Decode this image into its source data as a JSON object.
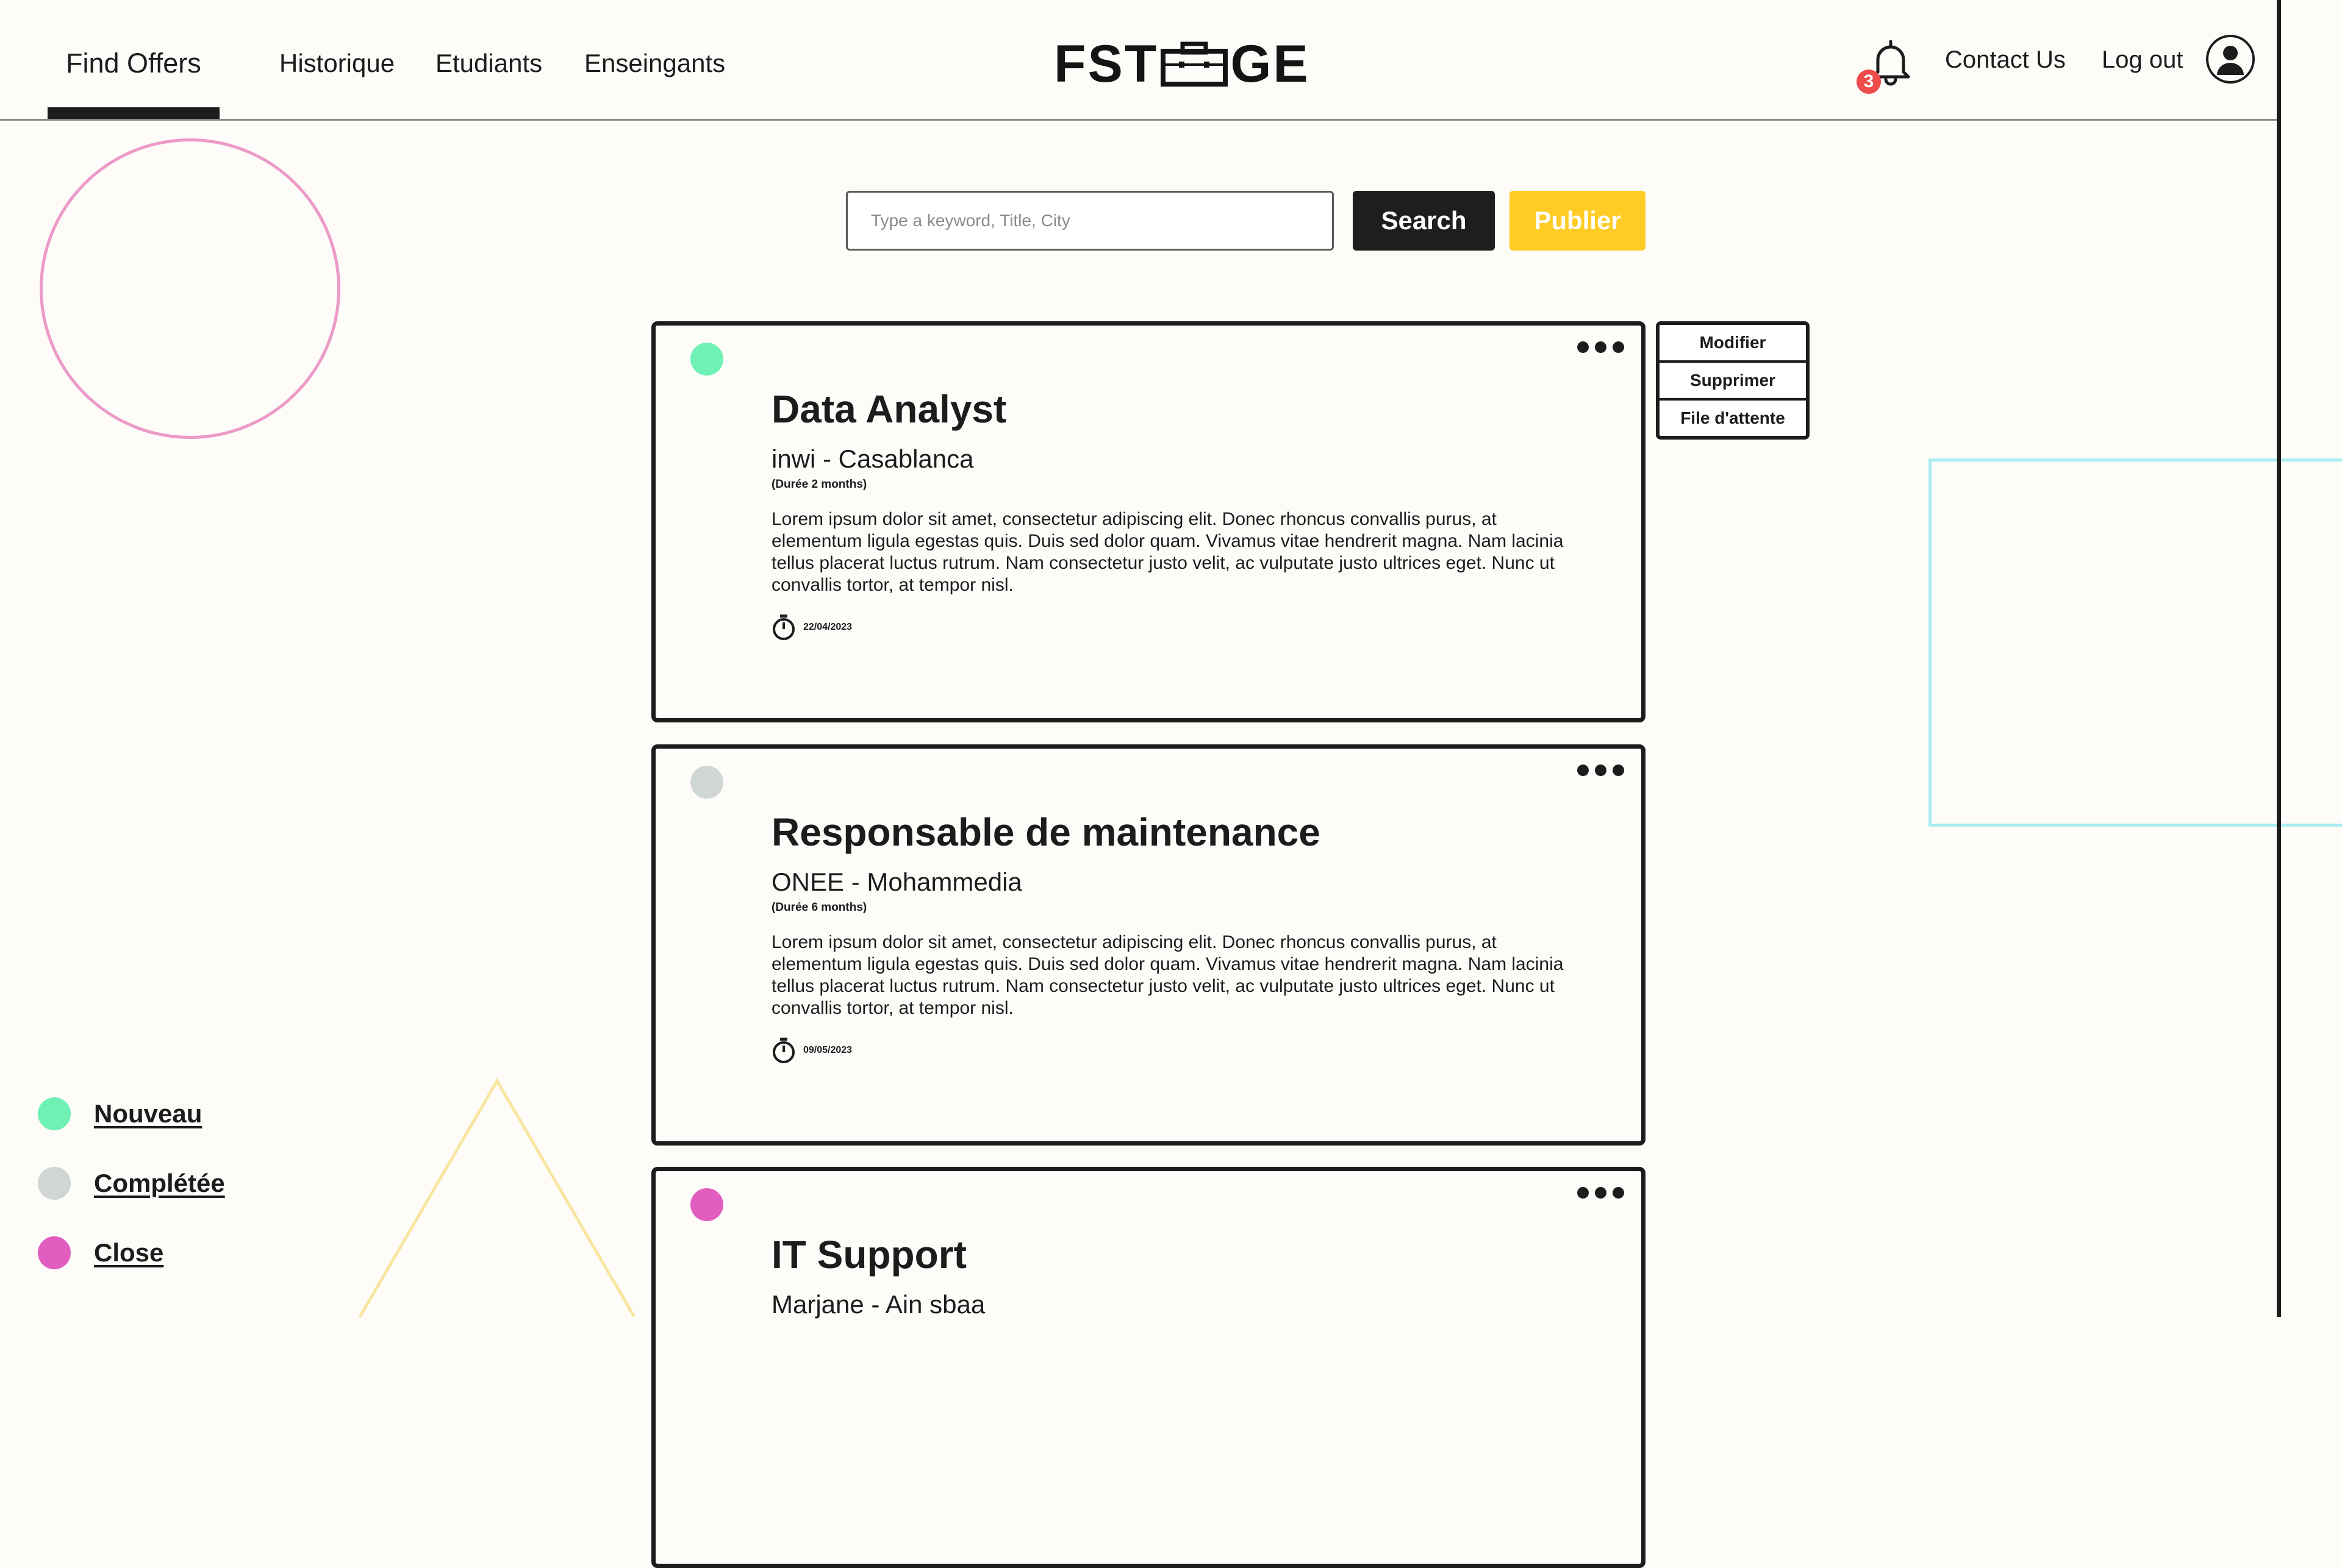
{
  "nav": {
    "items": [
      {
        "label": "Find Offers",
        "active": true
      },
      {
        "label": "Historique"
      },
      {
        "label": "Etudiants"
      },
      {
        "label": "Enseingants"
      }
    ]
  },
  "logo": {
    "left": "FST",
    "right": "GE"
  },
  "header_right": {
    "notifications_count": "3",
    "contact": "Contact Us",
    "logout": "Log out",
    "bell_icon": "bell-icon",
    "user_icon": "user-icon"
  },
  "search": {
    "placeholder": "Type a keyword, Title, City",
    "value": "",
    "search_label": "Search",
    "publish_label": "Publier"
  },
  "colors": {
    "new": "#6ff0b4",
    "completed": "#cfd6d3",
    "closed": "#e15ec0",
    "publish": "#fecc24",
    "accent_dark": "#1e1e1e"
  },
  "offers": [
    {
      "status": "new",
      "title": "Data Analyst",
      "company": "inwi - Casablanca",
      "duration": "(Durée 2 months)",
      "description": "Lorem ipsum dolor sit amet, consectetur adipiscing elit. Donec rhoncus convallis purus, at elementum ligula egestas quis. Duis sed dolor quam. Vivamus vitae hendrerit magna. Nam lacinia tellus placerat luctus rutrum. Nam consectetur justo velit, ac vulputate justo ultrices eget. Nunc ut convallis tortor, at tempor nisl.",
      "date": "22/04/2023"
    },
    {
      "status": "completed",
      "title": "Responsable de maintenance",
      "company": "ONEE - Mohammedia",
      "duration": "(Durée 6 months)",
      "description": "Lorem ipsum dolor sit amet, consectetur adipiscing elit. Donec rhoncus convallis purus, at elementum ligula egestas quis. Duis sed dolor quam. Vivamus vitae hendrerit magna. Nam lacinia tellus placerat luctus rutrum. Nam consectetur justo velit, ac vulputate justo ultrices eget. Nunc ut convallis tortor, at tempor nisl.",
      "date": "09/05/2023"
    },
    {
      "status": "closed",
      "title": "IT Support",
      "company": "Marjane - Ain sbaa",
      "duration": "",
      "description": "",
      "date": ""
    }
  ],
  "offer_menu": {
    "items": [
      {
        "label": "Modifier"
      },
      {
        "label": "Supprimer"
      },
      {
        "label": "File d'attente"
      }
    ]
  },
  "legend": [
    {
      "label": "Nouveau",
      "status": "new"
    },
    {
      "label": "Complétée",
      "status": "completed"
    },
    {
      "label": "Close",
      "status": "closed"
    }
  ]
}
